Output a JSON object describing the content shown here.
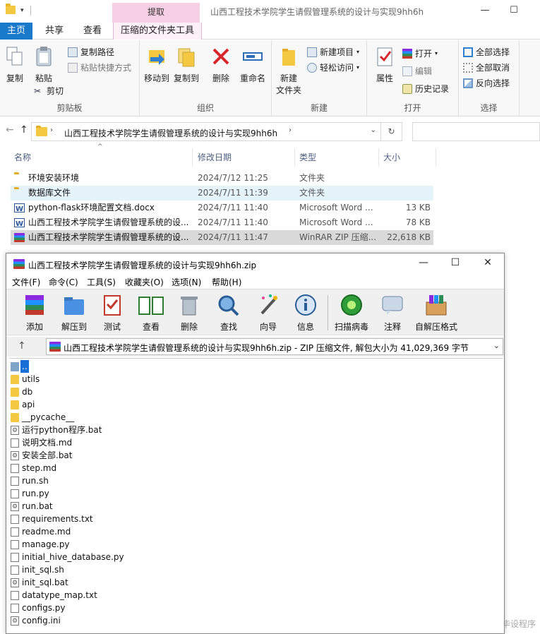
{
  "explorer": {
    "context_tab_header": "提取",
    "window_title": "山西工程技术学院学生请假管理系统的设计与实现9hh6h",
    "tabs": [
      "主页",
      "共享",
      "查看",
      "压缩的文件夹工具"
    ],
    "ribbon": {
      "clipboard": {
        "label": "剪贴板",
        "copy": "复制",
        "paste": "粘贴",
        "copy_path": "复制路径",
        "paste_shortcut": "粘贴快捷方式",
        "cut": "剪切"
      },
      "organize": {
        "label": "组织",
        "move_to": "移动到",
        "copy_to": "复制到",
        "delete": "删除",
        "rename": "重命名"
      },
      "new": {
        "label": "新建",
        "new_folder_line1": "新建",
        "new_folder_line2": "文件夹",
        "new_item": "新建项目",
        "easy_access": "轻松访问"
      },
      "open": {
        "label": "打开",
        "properties": "属性",
        "open": "打开",
        "edit": "编辑",
        "history": "历史记录"
      },
      "select": {
        "label": "选择",
        "select_all": "全部选择",
        "select_none": "全部取消",
        "invert": "反向选择"
      }
    },
    "address": "山西工程技术学院学生请假管理系统的设计与实现9hh6h",
    "columns": {
      "name": "名称",
      "date": "修改日期",
      "type": "类型",
      "size": "大小"
    },
    "files": [
      {
        "name": "环境安装环境",
        "date": "2024/7/12 11:25",
        "type": "文件夹",
        "size": "",
        "icon": "folder-icon"
      },
      {
        "name": "数据库文件",
        "date": "2024/7/11 11:39",
        "type": "文件夹",
        "size": "",
        "icon": "folder-icon"
      },
      {
        "name": "python-flask环境配置文档.docx",
        "date": "2024/7/11 11:40",
        "type": "Microsoft Word ...",
        "size": "13 KB",
        "icon": "word-icon"
      },
      {
        "name": "山西工程技术学院学生请假管理系统的设...",
        "date": "2024/7/11 11:40",
        "type": "Microsoft Word ...",
        "size": "78 KB",
        "icon": "word-icon"
      },
      {
        "name": "山西工程技术学院学生请假管理系统的设...",
        "date": "2024/7/11 11:47",
        "type": "WinRAR ZIP 压缩...",
        "size": "22,618 KB",
        "icon": "winrar-icon"
      }
    ]
  },
  "winrar": {
    "title": "山西工程技术学院学生请假管理系统的设计与实现9hh6h.zip",
    "menu": [
      "文件(F)",
      "命令(C)",
      "工具(S)",
      "收藏夹(O)",
      "选项(N)",
      "帮助(H)"
    ],
    "toolbar": [
      "添加",
      "解压到",
      "测试",
      "查看",
      "删除",
      "查找",
      "向导",
      "信息",
      "扫描病毒",
      "注释",
      "自解压格式"
    ],
    "path": "山西工程技术学院学生请假管理系统的设计与实现9hh6h.zip - ZIP 压缩文件, 解包大小为 41,029,369 字节",
    "items": [
      {
        "name": "..",
        "icon": "updir-icon"
      },
      {
        "name": "utils",
        "icon": "folder-icon"
      },
      {
        "name": "db",
        "icon": "folder-icon"
      },
      {
        "name": "api",
        "icon": "folder-icon"
      },
      {
        "name": "__pycache__",
        "icon": "folder-icon"
      },
      {
        "name": "运行python程序.bat",
        "icon": "bat-icon"
      },
      {
        "name": "说明文档.md",
        "icon": "file-icon"
      },
      {
        "name": "安装全部.bat",
        "icon": "bat-icon"
      },
      {
        "name": "step.md",
        "icon": "file-icon"
      },
      {
        "name": "run.sh",
        "icon": "file-icon"
      },
      {
        "name": "run.py",
        "icon": "file-icon"
      },
      {
        "name": "run.bat",
        "icon": "bat-icon"
      },
      {
        "name": "requirements.txt",
        "icon": "file-icon"
      },
      {
        "name": "readme.md",
        "icon": "file-icon"
      },
      {
        "name": "manage.py",
        "icon": "file-icon"
      },
      {
        "name": "initial_hive_database.py",
        "icon": "file-icon"
      },
      {
        "name": "init_sql.sh",
        "icon": "file-icon"
      },
      {
        "name": "init_sql.bat",
        "icon": "bat-icon"
      },
      {
        "name": "datatype_map.txt",
        "icon": "file-icon"
      },
      {
        "name": "configs.py",
        "icon": "file-icon"
      },
      {
        "name": "config.ini",
        "icon": "bat-icon"
      }
    ]
  },
  "watermark": "CSDN @召楠计算机毕设程序"
}
